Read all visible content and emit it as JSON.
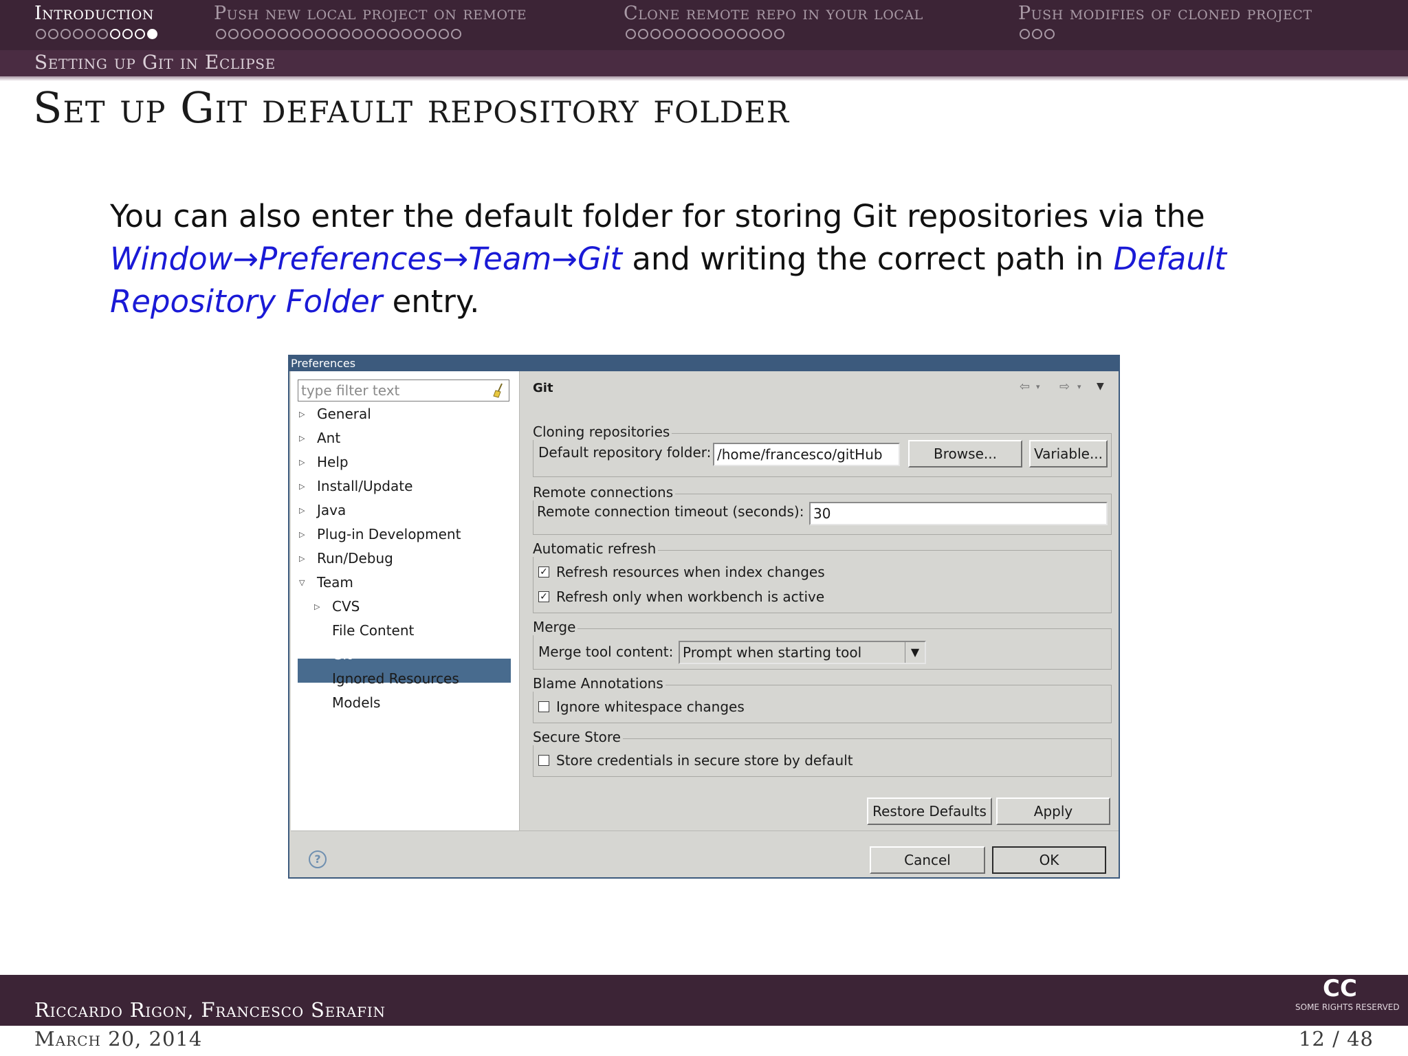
{
  "header": {
    "sections": [
      {
        "label": "Introduction",
        "current": true,
        "dots": 10,
        "filled_index": 9,
        "white_from": 6
      },
      {
        "label": "Push new local project on remote",
        "current": false,
        "dots": 20
      },
      {
        "label": "Clone remote repo in your local",
        "current": false,
        "dots": 13
      },
      {
        "label": "Push modifies of cloned project",
        "current": false,
        "dots": 3
      }
    ],
    "subsection": "Setting up Git in Eclipse"
  },
  "frame_title": "Set up Git default repository folder",
  "body": {
    "text1": "You can also enter the default folder for storing Git repositories via the ",
    "path": "Window→Preferences→Team→Git",
    "text2": " and writing the correct path in ",
    "entry": "Default Repository Folder",
    "text3": " entry."
  },
  "dialog": {
    "title": "Preferences",
    "filter_placeholder": "type filter text",
    "tree": [
      {
        "label": "General",
        "expander": "▷",
        "indent": 0
      },
      {
        "label": "Ant",
        "expander": "▷",
        "indent": 0
      },
      {
        "label": "Help",
        "expander": "▷",
        "indent": 0
      },
      {
        "label": "Install/Update",
        "expander": "▷",
        "indent": 0
      },
      {
        "label": "Java",
        "expander": "▷",
        "indent": 0
      },
      {
        "label": "Plug-in Development",
        "expander": "▷",
        "indent": 0
      },
      {
        "label": "Run/Debug",
        "expander": "▷",
        "indent": 0
      },
      {
        "label": "Team",
        "expander": "▽",
        "indent": 0
      },
      {
        "label": "CVS",
        "expander": "▷",
        "indent": 1
      },
      {
        "label": "File Content",
        "expander": "",
        "indent": 1
      },
      {
        "label": "Git",
        "expander": "▷",
        "indent": 1,
        "selected": true
      },
      {
        "label": "Ignored Resources",
        "expander": "",
        "indent": 1
      },
      {
        "label": "Models",
        "expander": "",
        "indent": 1
      }
    ],
    "page_title": "Git",
    "cloning": {
      "group": "Cloning repositories",
      "label": "Default repository folder:",
      "value": "/home/francesco/gitHub",
      "browse": "Browse...",
      "variable": "Variable..."
    },
    "remote": {
      "group": "Remote connections",
      "label": "Remote connection timeout (seconds):",
      "value": "30"
    },
    "refresh": {
      "group": "Automatic refresh",
      "opt1": "Refresh resources when index changes",
      "opt1_checked": true,
      "opt2": "Refresh only when workbench is active",
      "opt2_checked": true
    },
    "merge": {
      "group": "Merge",
      "label": "Merge tool content:",
      "value": "Prompt when starting tool"
    },
    "blame": {
      "group": "Blame Annotations",
      "opt": "Ignore whitespace changes",
      "checked": false
    },
    "secure": {
      "group": "Secure Store",
      "opt": "Store credentials in secure store by default",
      "checked": false
    },
    "restore_defaults": "Restore Defaults",
    "apply": "Apply",
    "cancel": "Cancel",
    "ok": "OK"
  },
  "footer": {
    "authors": "Riccardo Rigon, Francesco Serafin",
    "date": "March 20, 2014",
    "page": "12 / 48",
    "cc_big": "CC",
    "cc_small": "SOME RIGHTS RESERVED"
  }
}
